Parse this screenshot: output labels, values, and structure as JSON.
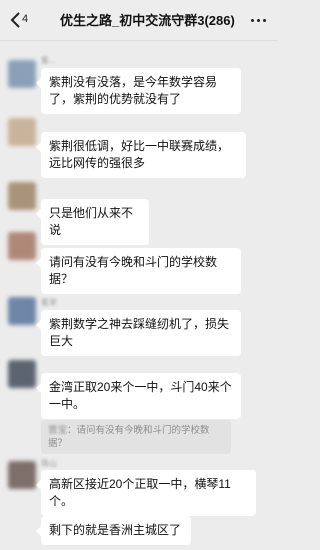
{
  "header": {
    "back_symbol": "‹",
    "unread_count": "4",
    "title": "优生之路_初中交流守群3(286)"
  },
  "messages": [
    {
      "name": "紫...",
      "text": "紫荆没有没落，是今年数学容易了，紫荆的优势就没有了",
      "avatar_color": "#8aa0b8"
    },
    {
      "name": "",
      "text": "紫荆很低调，好比一中联赛成绩，远比网传的强很多",
      "avatar_color": "#c8b49a"
    },
    {
      "name": "",
      "text": "只是他们从来不说",
      "avatar_color": "#a89478"
    },
    {
      "name": "",
      "text": "请问有没有今晚和斗门的学校数据？",
      "avatar_color": "#b08878"
    },
    {
      "name": "紫宋",
      "text": "紫荆数学之神去踩缝纫机了，损失巨大",
      "avatar_color": "#6f86a8"
    },
    {
      "name": "",
      "text": "金湾正取20来个一中，斗门40来个一中。",
      "avatar_color": "#5c6470",
      "quote_name": "曾宝",
      "quote_text": "请问有没有今晚和斗门的学校数据？"
    },
    {
      "name": "珠山",
      "text": "高新区接近20个正取一中，横琴11个。",
      "avatar_color": "#7d6f6a"
    },
    {
      "name": "",
      "text": "剩下的就是香洲主城区了",
      "avatar_color": ""
    }
  ]
}
